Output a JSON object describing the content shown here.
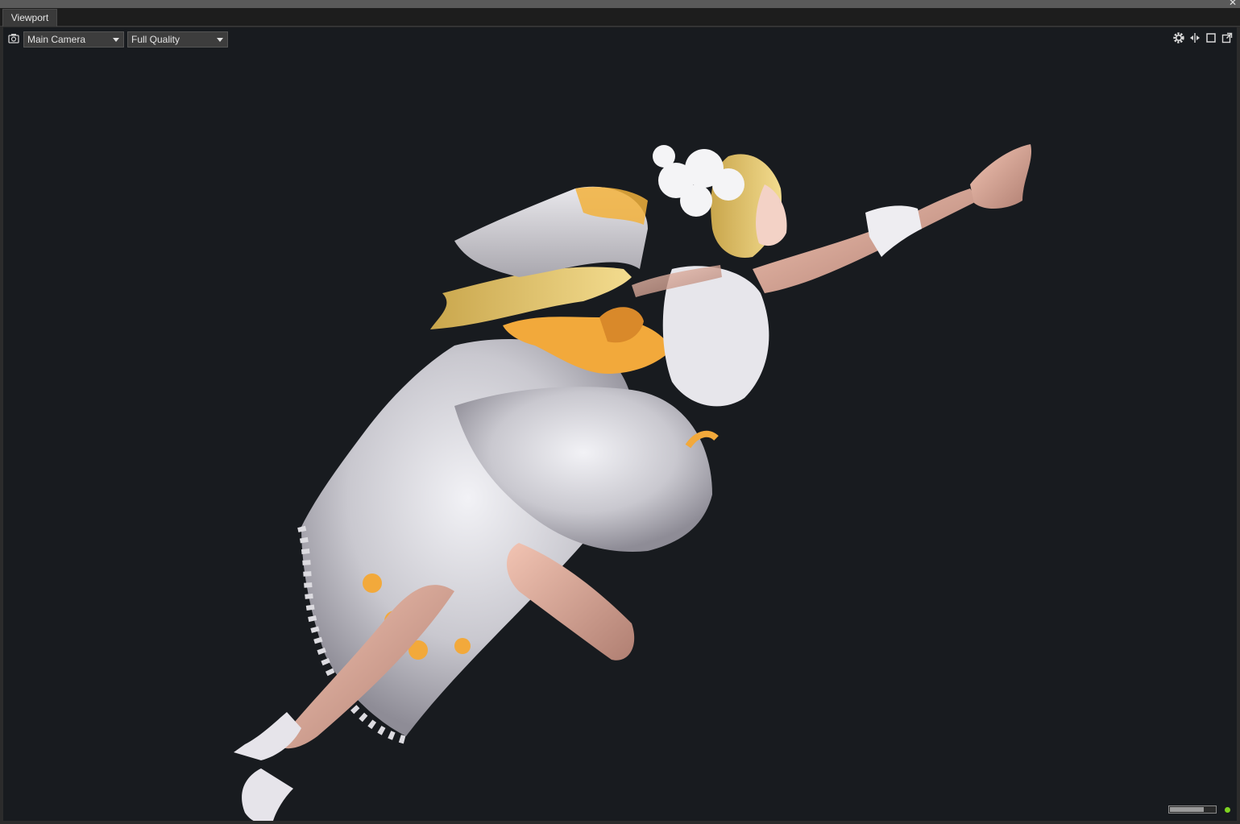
{
  "window": {
    "close_glyph": "✕",
    "tab_label": "Viewport"
  },
  "toolbar": {
    "camera_icon": "camera-icon",
    "camera_select": "Main Camera",
    "quality_select": "Full Quality",
    "right_icons": [
      "gear-icon",
      "split-view-icon",
      "maximize-icon",
      "popout-icon"
    ]
  },
  "scene": {
    "content": "3d-character-render"
  },
  "status": {
    "progress": 0.75,
    "indicator_color": "#7ed321"
  },
  "colors": {
    "viewport_bg": "#181b1f",
    "tab_bg": "#3a3a3a",
    "dropdown_bg": "#3d3d3d",
    "accent_orange": "#f2a93b"
  }
}
